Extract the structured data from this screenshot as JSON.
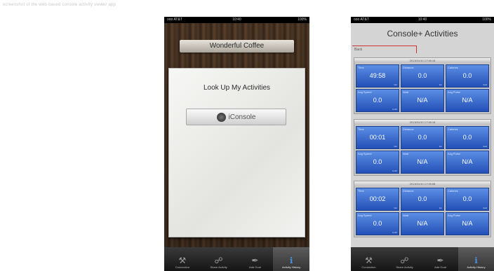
{
  "caption": "screenshot of the web-based console activity viewer app",
  "left_phone": {
    "status": {
      "carrier": "ooo AT&T",
      "time": "10:40",
      "battery": "100%"
    },
    "banner": "Wonderful Coffee",
    "paper_title": "Look Up My Activities",
    "console_button": "iConsole"
  },
  "right_phone": {
    "status": {
      "carrier": "ooo AT&T",
      "time": "10:40",
      "battery": "100%"
    },
    "title": "Console+ Activities",
    "back_label": "Back",
    "cards": [
      {
        "header": "2013/01/10 17:06:18",
        "cells": [
          {
            "label": "Time",
            "value": "49:58",
            "unit": "min"
          },
          {
            "label": "Distance",
            "value": "0.0",
            "unit": "km"
          },
          {
            "label": "Calories",
            "value": "0.0",
            "unit": "kcal"
          },
          {
            "label": "Avg Speed",
            "value": "0.0",
            "unit": "km/h"
          },
          {
            "label": "Watt",
            "value": "N/A",
            "unit": ""
          },
          {
            "label": "Avg Pulse",
            "value": "N/A",
            "unit": ""
          }
        ]
      },
      {
        "header": "2013/01/10 17:06:18",
        "cells": [
          {
            "label": "Time",
            "value": "00:01",
            "unit": "min"
          },
          {
            "label": "Distance",
            "value": "0.0",
            "unit": "km"
          },
          {
            "label": "Calories",
            "value": "0.0",
            "unit": "kcal"
          },
          {
            "label": "Avg Speed",
            "value": "0.0",
            "unit": "km/h"
          },
          {
            "label": "Watt",
            "value": "N/A",
            "unit": ""
          },
          {
            "label": "Avg Pulse",
            "value": "N/A",
            "unit": ""
          }
        ]
      },
      {
        "header": "2013/01/10 17:05:58",
        "cells": [
          {
            "label": "Time",
            "value": "00:02",
            "unit": "min"
          },
          {
            "label": "Distance",
            "value": "0.0",
            "unit": "km"
          },
          {
            "label": "Calories",
            "value": "0.0",
            "unit": "kcal"
          },
          {
            "label": "Avg Speed",
            "value": "0.0",
            "unit": "km/h"
          },
          {
            "label": "Watt",
            "value": "N/A",
            "unit": ""
          },
          {
            "label": "Avg Pulse",
            "value": "N/A",
            "unit": ""
          }
        ]
      }
    ]
  },
  "tabbar": [
    {
      "label": "Connection",
      "icon": "dumbbell-icon"
    },
    {
      "label": "Share Activity",
      "icon": "link-icon"
    },
    {
      "label": "Add Goal",
      "icon": "wrench-icon"
    },
    {
      "label": "Activity History",
      "icon": "info-icon"
    }
  ],
  "colors": {
    "tile_blue": "#2f5fc9",
    "active_tab_icon": "#4a8fe0",
    "wood": "#4b3524"
  }
}
